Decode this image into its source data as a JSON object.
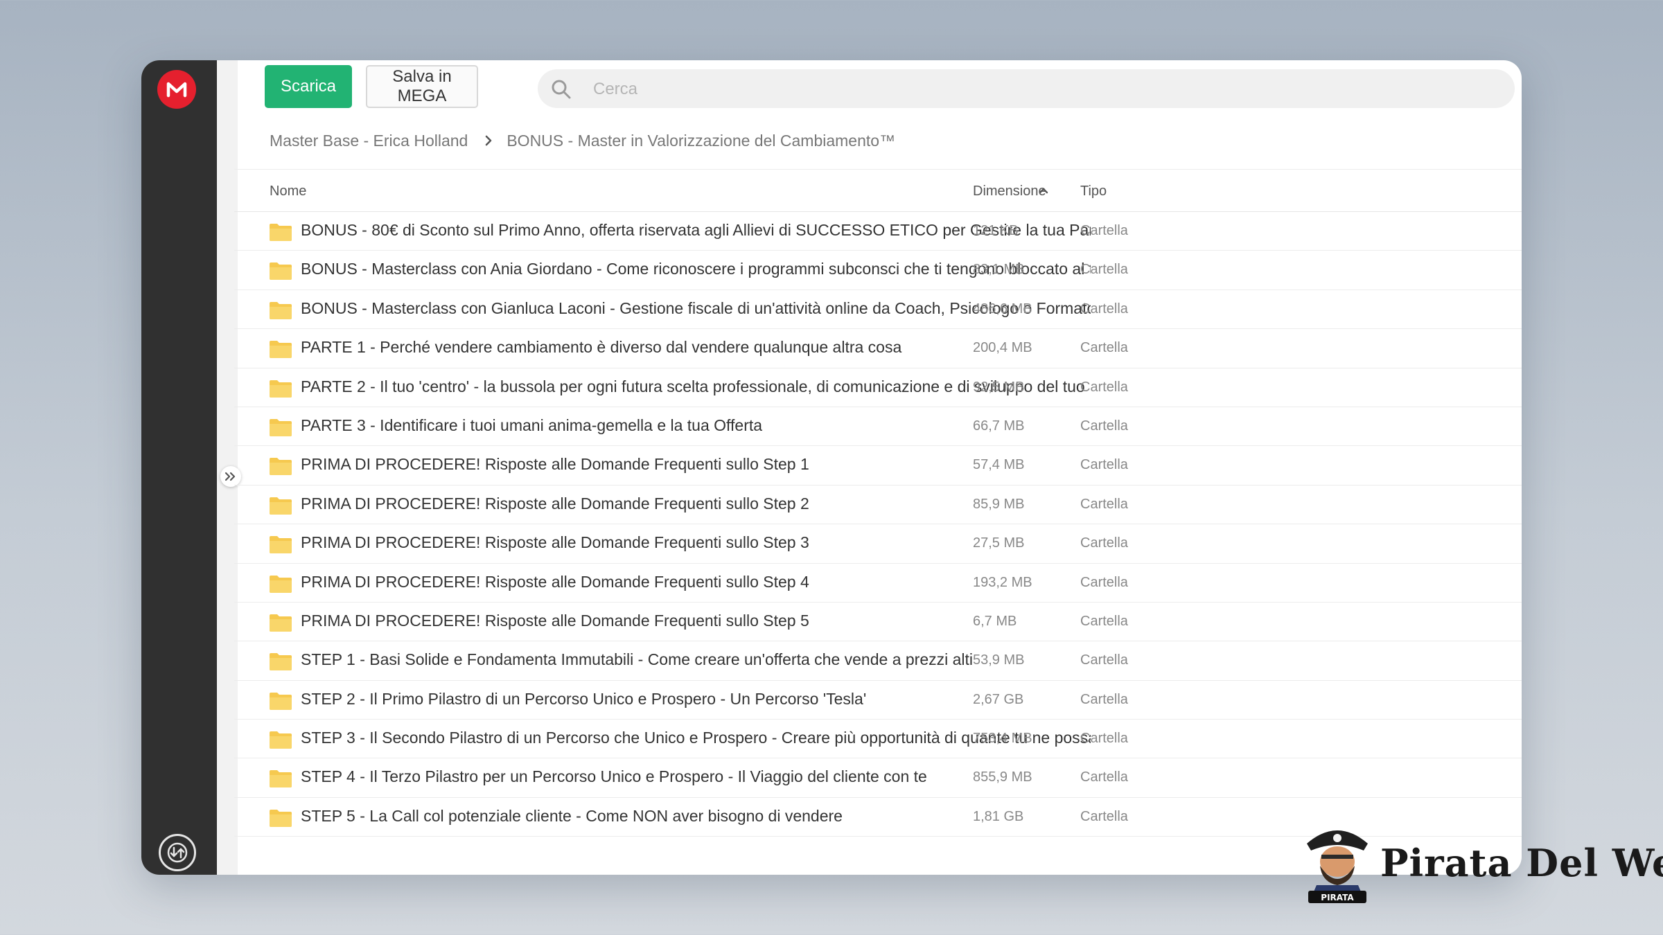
{
  "toolbar": {
    "download_label": "Scarica",
    "save_label": "Salva in MEGA"
  },
  "search": {
    "placeholder": "Cerca"
  },
  "breadcrumb": {
    "items": [
      "Master Base - Erica Holland",
      "BONUS - Master in Valorizzazione del Cambiamento™"
    ]
  },
  "table": {
    "columns": {
      "name": "Nome",
      "size": "Dimensione",
      "type": "Tipo"
    },
    "rows": [
      {
        "name": "BONUS - 80€ di Sconto sul Primo Anno, offerta riservata agli Allievi di SUCCESSO ETICO per Gestire la tua Partita IVA",
        "size": "121 KB",
        "type": "Cartella"
      },
      {
        "name": "BONUS - Masterclass con Ania Giordano - Come riconoscere i programmi subconsci che ti tengono bloccato al tuo attuale livell...",
        "size": "83,1 MB",
        "type": "Cartella"
      },
      {
        "name": "BONUS - Masterclass con Gianluca Laconi - Gestione fiscale di un'attività online da Coach, Psicologo o Formatore",
        "size": "486,6 MB",
        "type": "Cartella"
      },
      {
        "name": "PARTE 1 - Perché vendere cambiamento è diverso dal vendere qualunque altra cosa",
        "size": "200,4 MB",
        "type": "Cartella"
      },
      {
        "name": "PARTE 2 - Il tuo 'centro' - la bussola per ogni futura scelta professionale, di comunicazione e di sviluppo del tuo Percorso",
        "size": "92,5 MB",
        "type": "Cartella"
      },
      {
        "name": "PARTE 3 - Identificare i tuoi umani anima-gemella e la tua Offerta",
        "size": "66,7 MB",
        "type": "Cartella"
      },
      {
        "name": "PRIMA DI PROCEDERE! Risposte alle Domande Frequenti sullo Step 1",
        "size": "57,4 MB",
        "type": "Cartella"
      },
      {
        "name": "PRIMA DI PROCEDERE! Risposte alle Domande Frequenti sullo Step 2",
        "size": "85,9 MB",
        "type": "Cartella"
      },
      {
        "name": "PRIMA DI PROCEDERE! Risposte alle Domande Frequenti sullo Step 3",
        "size": "27,5 MB",
        "type": "Cartella"
      },
      {
        "name": "PRIMA DI PROCEDERE! Risposte alle Domande Frequenti sullo Step 4",
        "size": "193,2 MB",
        "type": "Cartella"
      },
      {
        "name": "PRIMA DI PROCEDERE! Risposte alle Domande Frequenti sullo Step 5",
        "size": "6,7 MB",
        "type": "Cartella"
      },
      {
        "name": "STEP 1 - Basi Solide e Fondamenta Immutabili - Come creare un'offerta che vende a prezzi alti",
        "size": "53,9 MB",
        "type": "Cartella"
      },
      {
        "name": "STEP 2 - Il Primo Pilastro di un Percorso Unico e Prospero - Un Percorso 'Tesla'",
        "size": "2,67 GB",
        "type": "Cartella"
      },
      {
        "name": "STEP 3 - Il Secondo Pilastro di un Percorso che Unico e Prospero - Creare più opportunità di quante tu ne possa gestire",
        "size": "753,4 MB",
        "type": "Cartella"
      },
      {
        "name": "STEP 4 - Il Terzo Pilastro per un Percorso Unico e Prospero - Il Viaggio del cliente con te",
        "size": "855,9 MB",
        "type": "Cartella"
      },
      {
        "name": "STEP 5 - La Call col potenziale cliente - Come NON aver bisogno di vendere",
        "size": "1,81 GB",
        "type": "Cartella"
      }
    ]
  },
  "watermark": {
    "brand": "Pirata Del Web",
    "badge": "PIRATA"
  },
  "colors": {
    "accent": "#22b373",
    "mega_red": "#e5202e",
    "folder": "#f6c94f",
    "sidebar": "#303030"
  }
}
